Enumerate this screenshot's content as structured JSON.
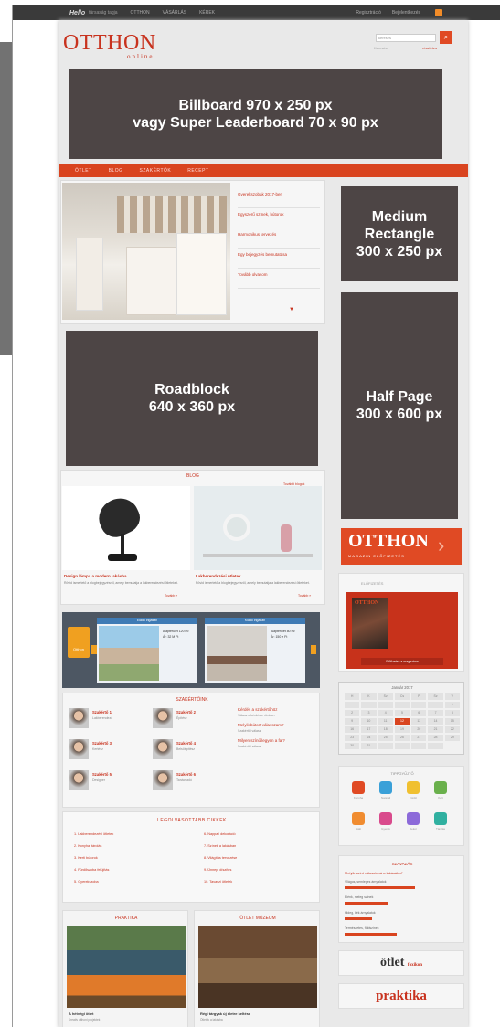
{
  "topbar": {
    "brand": "Hello",
    "tagline": "társaság tagja",
    "links": [
      "OTTHON",
      "VÁSÁRLÁS",
      "KÉREK"
    ],
    "right_links": [
      "Regisztráció",
      "Bejelentkezés"
    ]
  },
  "header": {
    "logo": "OTTHON",
    "logo_sub": "online",
    "search_placeholder": "keresés",
    "search_label": "Keresés",
    "search_link": "részletes",
    "search_button": "⌕"
  },
  "ads": {
    "billboard_line1": "Billboard 970 x 250 px",
    "billboard_line2": "vagy Super Leaderboard 70 x 90 px",
    "medium_rect_line1": "Medium",
    "medium_rect_line2": "Rectangle",
    "medium_rect_line3": "300 x 250 px",
    "roadblock_line1": "Roadblock",
    "roadblock_line2": "640 x 360 px",
    "halfpage_line1": "Half Page",
    "halfpage_line2": "300 x 600 px"
  },
  "nav": {
    "items": [
      "ÖTLET",
      "BLOG",
      "SZAKÉRTŐK",
      "RECEPT"
    ]
  },
  "featured": {
    "items": [
      "Gyerekszobák 2017-ben",
      "Egyszerű színek, bútorok",
      "Harmonikus tervezés",
      "Egy bejegyzés bemutatása",
      "Tovább olvasom"
    ],
    "arrow": "▼"
  },
  "blog": {
    "section_title": "BLOG",
    "more_link": "További blogok",
    "item1_title": "Design lámpa a modern lakásba",
    "item1_body": "Rövid ismertető a blogbejegyzésről, amely bemutatja a lakberendezési ötleteket.",
    "item1_more": "Tovább »",
    "item2_title": "Lakberendezési ötletek",
    "item2_body": "Rövid ismertető a blogbejegyzésről, amely bemutatja a lakberendezési ötleteket.",
    "item2_more": "Tovább »"
  },
  "otthon_banner": {
    "title": "OTTHON",
    "subtitle": "MAGAZIN ELŐFIZETÉS",
    "arrow": "›"
  },
  "magazine": {
    "label": "ELŐFIZETÉS",
    "cover_title": "OTTHON",
    "button": "Előfizetek a magazinra"
  },
  "carousel": {
    "card1_head": "Eladó ingatlan",
    "card1_price": "Alapterület 120 m²",
    "card1_price2": "Ár: 32 M Ft",
    "card2_head": "Kiadó ingatlan",
    "card2_price": "Alapterület 80 m²",
    "card2_price2": "Ár: 150 e Ft",
    "logo_label": "Otthon"
  },
  "experts": {
    "section_title": "SZAKÉRTŐINK",
    "people": [
      {
        "name": "Szakértő 1",
        "role": "Lakberendező"
      },
      {
        "name": "Szakértő 2",
        "role": "Építész"
      },
      {
        "name": "Szakértő 3",
        "role": "Kertész"
      },
      {
        "name": "Szakértő 4",
        "role": "Belsőépítész"
      },
      {
        "name": "Szakértő 5",
        "role": "Designer"
      },
      {
        "name": "Szakértő 6",
        "role": "Tanácsadó"
      }
    ],
    "questions": [
      {
        "q": "Kérdés a szakértőhöz",
        "a": "Válasz a kérdésre röviden"
      },
      {
        "q": "Melyik bútort válasszam?",
        "a": "Szakértői válasz"
      },
      {
        "q": "Milyen színű legyen a fal?",
        "a": "Szakértői válasz"
      }
    ]
  },
  "calendar": {
    "title": "Január 2017",
    "days": [
      "H",
      "K",
      "Sz",
      "Cs",
      "P",
      "Sz",
      "V",
      "",
      "",
      "",
      "",
      "",
      "",
      "1",
      "2",
      "3",
      "4",
      "5",
      "6",
      "7",
      "8",
      "9",
      "10",
      "11",
      "12",
      "13",
      "14",
      "15",
      "16",
      "17",
      "18",
      "19",
      "20",
      "21",
      "22",
      "23",
      "24",
      "25",
      "26",
      "27",
      "28",
      "29",
      "30",
      "31",
      "",
      "",
      "",
      ""
    ],
    "highlight_index": 24
  },
  "tips": {
    "title": "TIPPGYŰJTŐ",
    "labels": [
      "Konyha",
      "Nappali",
      "Fürdő",
      "Kert",
      "Háló",
      "Gyerek",
      "Dekor",
      "Tárolás"
    ],
    "colors": [
      "#e04a24",
      "#3aa0d8",
      "#f0c030",
      "#6ab04c",
      "#f08c30",
      "#d94a8c",
      "#8c6ad9",
      "#30b0a0"
    ]
  },
  "poll": {
    "title": "SZAVAZÁS",
    "question": "Melyik színt választaná a lakásába?",
    "options": [
      "Világos, semleges árnyalatok",
      "Élénk, meleg színek",
      "Hideg, kék árnyalatok",
      "Természetes, földszínek"
    ],
    "values": [
      0.62,
      0.38,
      0.24,
      0.46
    ]
  },
  "partner_logos": {
    "otlet": "ötlet",
    "otlet_tag": "foxikon",
    "praktika": "praktika"
  },
  "recipes": {
    "title": "LEGOLVASOTTABB CIKKEK",
    "left": [
      "1. Lakberendezési ötletek",
      "2. Konyhai tárolás",
      "3. Kerti bútorok",
      "4. Fürdőszoba felújítás",
      "5. Gyerekszoba"
    ],
    "right": [
      "6. Nappali dekoráció",
      "7. Színek a lakásban",
      "8. Világítás tervezése",
      "9. Ünnepi díszítés",
      "10. Tavaszi ötletek"
    ]
  },
  "bottom": {
    "card1_title": "PRAKTIKA",
    "card1_caption": "A hétvégi ötlet",
    "card1_sub": "Kreatív otthoni projektek",
    "card2_title": "ÖTLET MÚZEUM",
    "card2_caption": "Régi tárgyak új életre keltése",
    "card2_sub": "Ötletek a lakásba"
  }
}
